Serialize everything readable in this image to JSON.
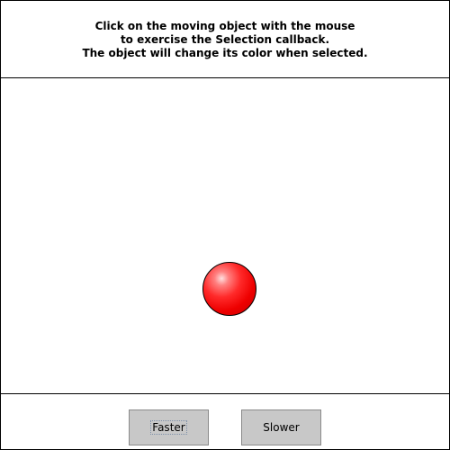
{
  "instructions": {
    "line1": "Click on the moving object with the mouse",
    "line2": "to exercise the Selection callback.",
    "line3": "The object will change its color when selected."
  },
  "canvas": {
    "object": {
      "shape": "sphere",
      "color": "#ff0000",
      "selected": false
    }
  },
  "controls": {
    "faster_label": "Faster",
    "slower_label": "Slower"
  }
}
